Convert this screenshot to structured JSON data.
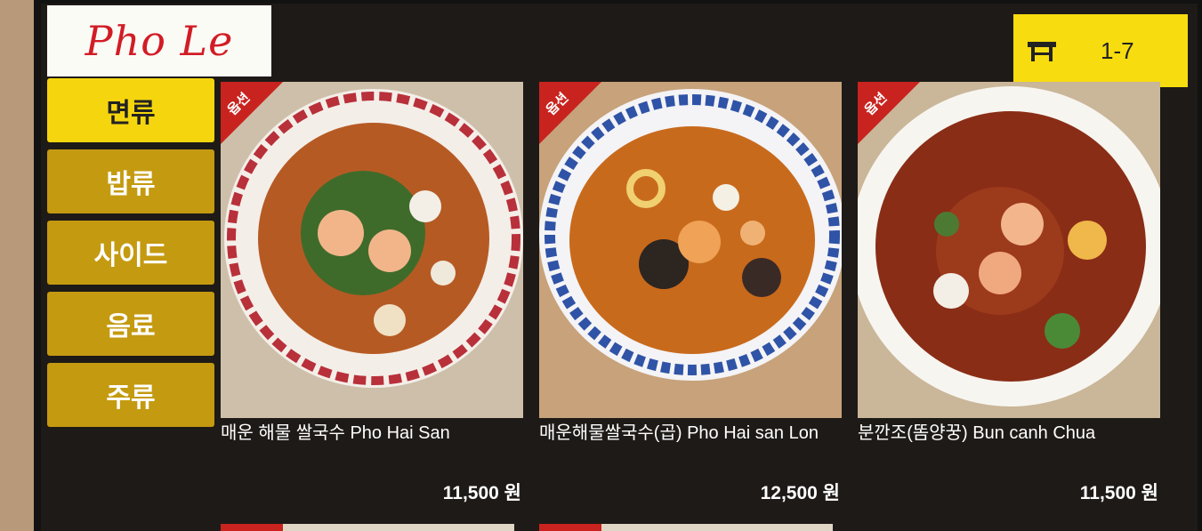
{
  "brand": {
    "logo_text": "Pho Le",
    "logo_color": "#d21c25"
  },
  "table": {
    "icon": "table-icon",
    "number": "1-7"
  },
  "colors": {
    "accent": "#f5d60e",
    "category": "#c49a10",
    "ribbon": "#c8231e"
  },
  "categories": [
    {
      "label": "면류",
      "active": true
    },
    {
      "label": "밥류",
      "active": false
    },
    {
      "label": "사이드",
      "active": false
    },
    {
      "label": "음료",
      "active": false
    },
    {
      "label": "주류",
      "active": false
    }
  ],
  "items": [
    {
      "ribbon": "옵션",
      "name": "매운 해물 쌀국수  Pho Hai San",
      "price": "11,500 원"
    },
    {
      "ribbon": "옵션",
      "name": "매운해물쌀국수(곱)  Pho Hai san Lon",
      "price": "12,500 원"
    },
    {
      "ribbon": "옵션",
      "name": "분깐조(똠양꿍)  Bun canh Chua",
      "price": "11,500 원"
    }
  ]
}
